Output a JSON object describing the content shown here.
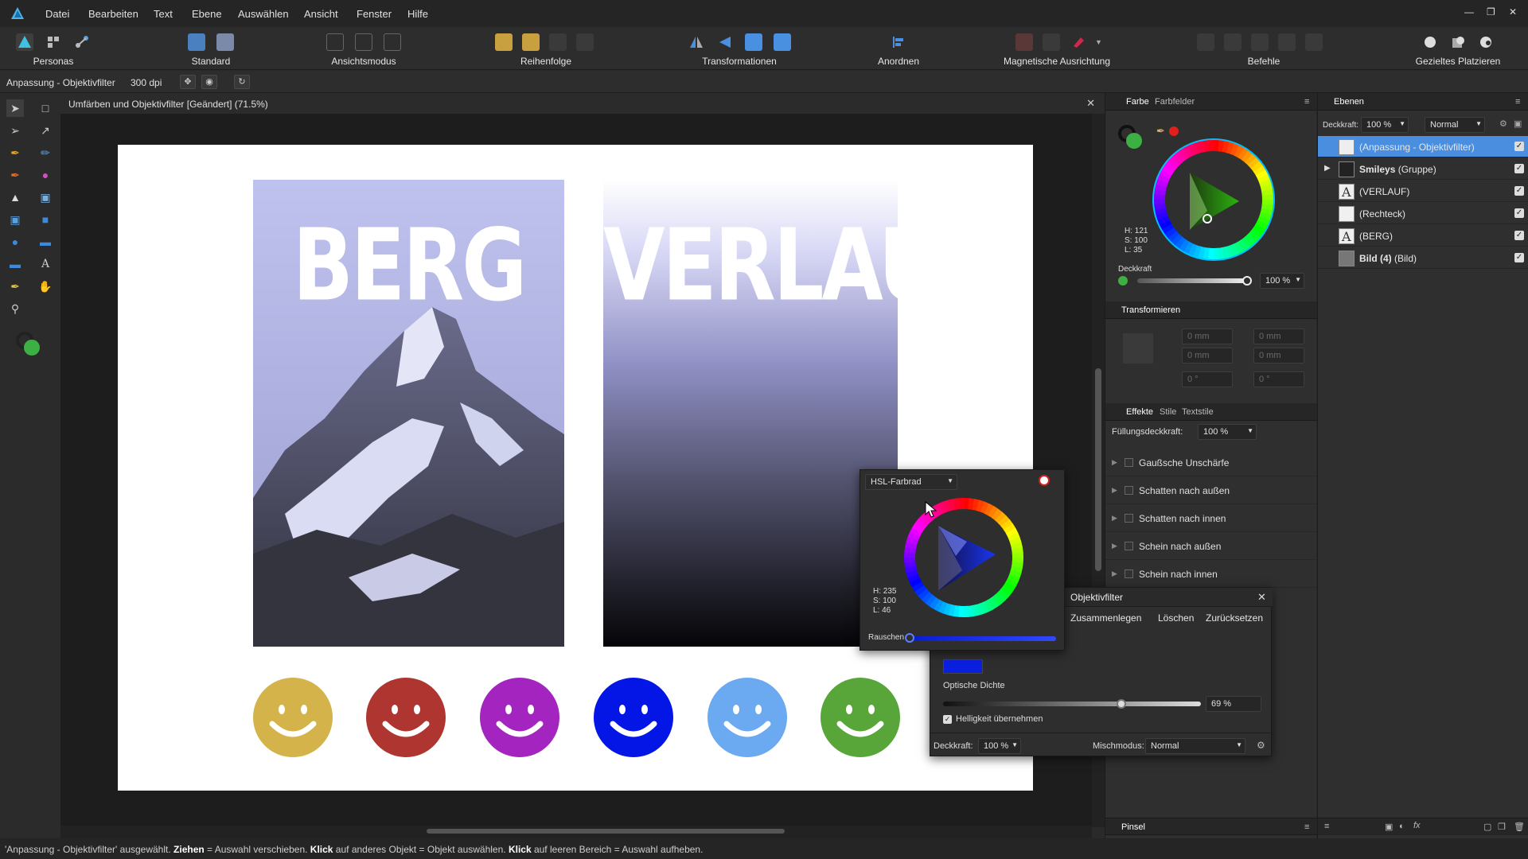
{
  "menu": [
    "Datei",
    "Bearbeiten",
    "Text",
    "Ebene",
    "Auswählen",
    "Ansicht",
    "Fenster",
    "Hilfe"
  ],
  "toolbar": {
    "groups": [
      "Personas",
      "Standard",
      "Ansichtsmodus",
      "Reihenfolge",
      "Transformationen",
      "Anordnen",
      "Magnetische Ausrichtung",
      "Befehle",
      "Gezieltes Platzieren"
    ]
  },
  "context": {
    "tool": "Anpassung - Objektivfilter",
    "dpi": "300 dpi"
  },
  "document": {
    "title": "Umfärben und Objektivfilter [Geändert] (71.5%)"
  },
  "artboard": {
    "title_left": "BERG",
    "title_right": "VERLAUF"
  },
  "smileys": [
    {
      "color": "#d4b34a"
    },
    {
      "color": "#ae3530"
    },
    {
      "color": "#a324bf"
    },
    {
      "color": "#0316e6"
    },
    {
      "color": "#6ba9f0"
    },
    {
      "color": "#58a63a"
    }
  ],
  "color_panel": {
    "tabs": [
      "Farbe",
      "Farbfelder"
    ],
    "h": "H: 121",
    "s": "S: 100",
    "l": "L: 35",
    "opacity_label": "Deckkraft",
    "opacity_value": "100 %"
  },
  "transform_panel": {
    "title": "Transformieren",
    "fields": [
      "0 mm",
      "0 mm",
      "0 mm",
      "0 mm",
      "0 °",
      "0 °"
    ]
  },
  "effects_panel": {
    "tabs": [
      "Effekte",
      "Stile",
      "Textstile"
    ],
    "fill_opacity_label": "Füllungsdeckkraft:",
    "fill_opacity_value": "100 %",
    "effects": [
      "Gaußsche Unschärfe",
      "Schatten nach außen",
      "Schatten nach innen",
      "Schein nach außen",
      "Schein nach innen"
    ]
  },
  "brush_panel": {
    "title": "Pinsel"
  },
  "layers_panel": {
    "tab": "Ebenen",
    "opacity_label": "Deckkraft:",
    "opacity_value": "100 %",
    "blend_mode": "Normal",
    "layers": [
      {
        "name": "(Anpassung - Objektivfilter)",
        "bold": ""
      },
      {
        "name": " (Gruppe)",
        "bold": "Smileys"
      },
      {
        "name": "(VERLAUF)",
        "bold": ""
      },
      {
        "name": "(Rechteck)",
        "bold": ""
      },
      {
        "name": "(BERG)",
        "bold": ""
      },
      {
        "name": " (Bild)",
        "bold": "Bild (4)"
      }
    ]
  },
  "hsl_popup": {
    "mode": "HSL-Farbrad",
    "h": "H: 235",
    "s": "S: 100",
    "l": "L: 46",
    "noise_label": "Rauschen",
    "noise_value": 0
  },
  "filter_panel": {
    "title": "Objektivfilter",
    "buttons": [
      "Zusammenlegen",
      "Löschen",
      "Zurücksetzen"
    ],
    "swatch_color": "#0b1fe0",
    "density_label": "Optische Dichte",
    "density_value": "69 %",
    "density_fraction": 0.69,
    "preserve_luminosity": "Helligkeit übernehmen",
    "opacity_label": "Deckkraft:",
    "opacity_value": "100 %",
    "blend_label": "Mischmodus:",
    "blend_value": "Normal"
  },
  "status": {
    "p1": "'Anpassung - Objektivfilter' ausgewählt. ",
    "b1": "Ziehen",
    "p2": " = Auswahl verschieben. ",
    "b2": "Klick",
    "p3": " auf anderes Objekt = Objekt auswählen. ",
    "b3": "Klick",
    "p4": " auf leeren Bereich = Auswahl aufheben."
  }
}
